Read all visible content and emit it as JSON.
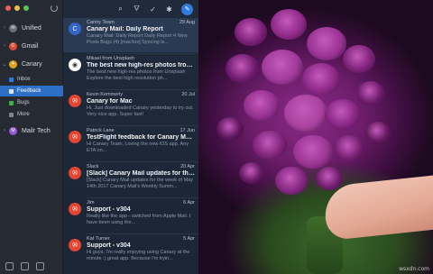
{
  "sidebar": {
    "accounts": [
      {
        "label": "Unified",
        "color": "#6a6f78",
        "glyph": "✉"
      },
      {
        "label": "Gmail",
        "color": "#d64a3b",
        "glyph": "G"
      },
      {
        "label": "Canary",
        "color": "#e0a21c",
        "glyph": "✦"
      },
      {
        "label": "Mailr Tech",
        "color": "#8e5ad1",
        "glyph": "M"
      }
    ],
    "folders": [
      {
        "label": "Inbox",
        "color": "#2f7bdc"
      },
      {
        "label": "Feedback",
        "color": "#7b8594"
      },
      {
        "label": "Bugs",
        "color": "#3fae4f"
      },
      {
        "label": "More",
        "color": "#7b8594"
      }
    ]
  },
  "messages": [
    {
      "from": "Canny Team",
      "date": "29 Aug",
      "subject": "Canary Mail: Daily Report",
      "preview": "Canary Mail: Daily Report Daily Report 4 New Posts Bugs (4) [mac/ios] Syncing is...",
      "avatar_color": "#3563c9",
      "avatar_glyph": "C"
    },
    {
      "from": "Mikael from Unsplash",
      "date": "",
      "subject": "The best new high-res photos from...",
      "preview": "The best new high-res photos from Unsplash Explore the best high resolution ph...",
      "avatar_color": "#ffffff",
      "avatar_glyph": "◉"
    },
    {
      "from": "Kevin Kemmerly",
      "date": "20 Jul",
      "subject": "Canary for Mac",
      "preview": "Hi, Just downloaded Canary yesterday to try out. Very nice app. Super fast!",
      "avatar_color": "#e6452f",
      "avatar_glyph": "✉"
    },
    {
      "from": "Patrick Lane",
      "date": "17 Jun",
      "subject": "TestFlight feedback for Canary Mail...",
      "preview": "Hi Canary Team, Loving the new iOS app. Any ETA on...",
      "avatar_color": "#e6452f",
      "avatar_glyph": "✉"
    },
    {
      "from": "Slack",
      "date": "20 Apr",
      "subject": "[Slack] Canary Mail updates for the...",
      "preview": "[Slack] Canary Mail updates for the week of May 14th 2017 Canary Mail's Weekly Summ...",
      "avatar_color": "#e6452f",
      "avatar_glyph": "✉"
    },
    {
      "from": "Jim",
      "date": "6 Apr",
      "subject": "Support - v304",
      "preview": "Really like the app - switched from Apple Mail. I have been using the...",
      "avatar_color": "#e6452f",
      "avatar_glyph": "✉"
    },
    {
      "from": "Kat Turner",
      "date": "5 Apr",
      "subject": "Support - v304",
      "preview": "Hi guys, I'm really enjoying using Canary at the minute :) great app. Because I'm tryin...",
      "avatar_color": "#e6452f",
      "avatar_glyph": "✉"
    }
  ],
  "toolbar": [
    "search-icon",
    "filter-icon",
    "read-all-icon",
    "tools-icon",
    "compose-icon"
  ],
  "watermark": "wsxdn.com"
}
